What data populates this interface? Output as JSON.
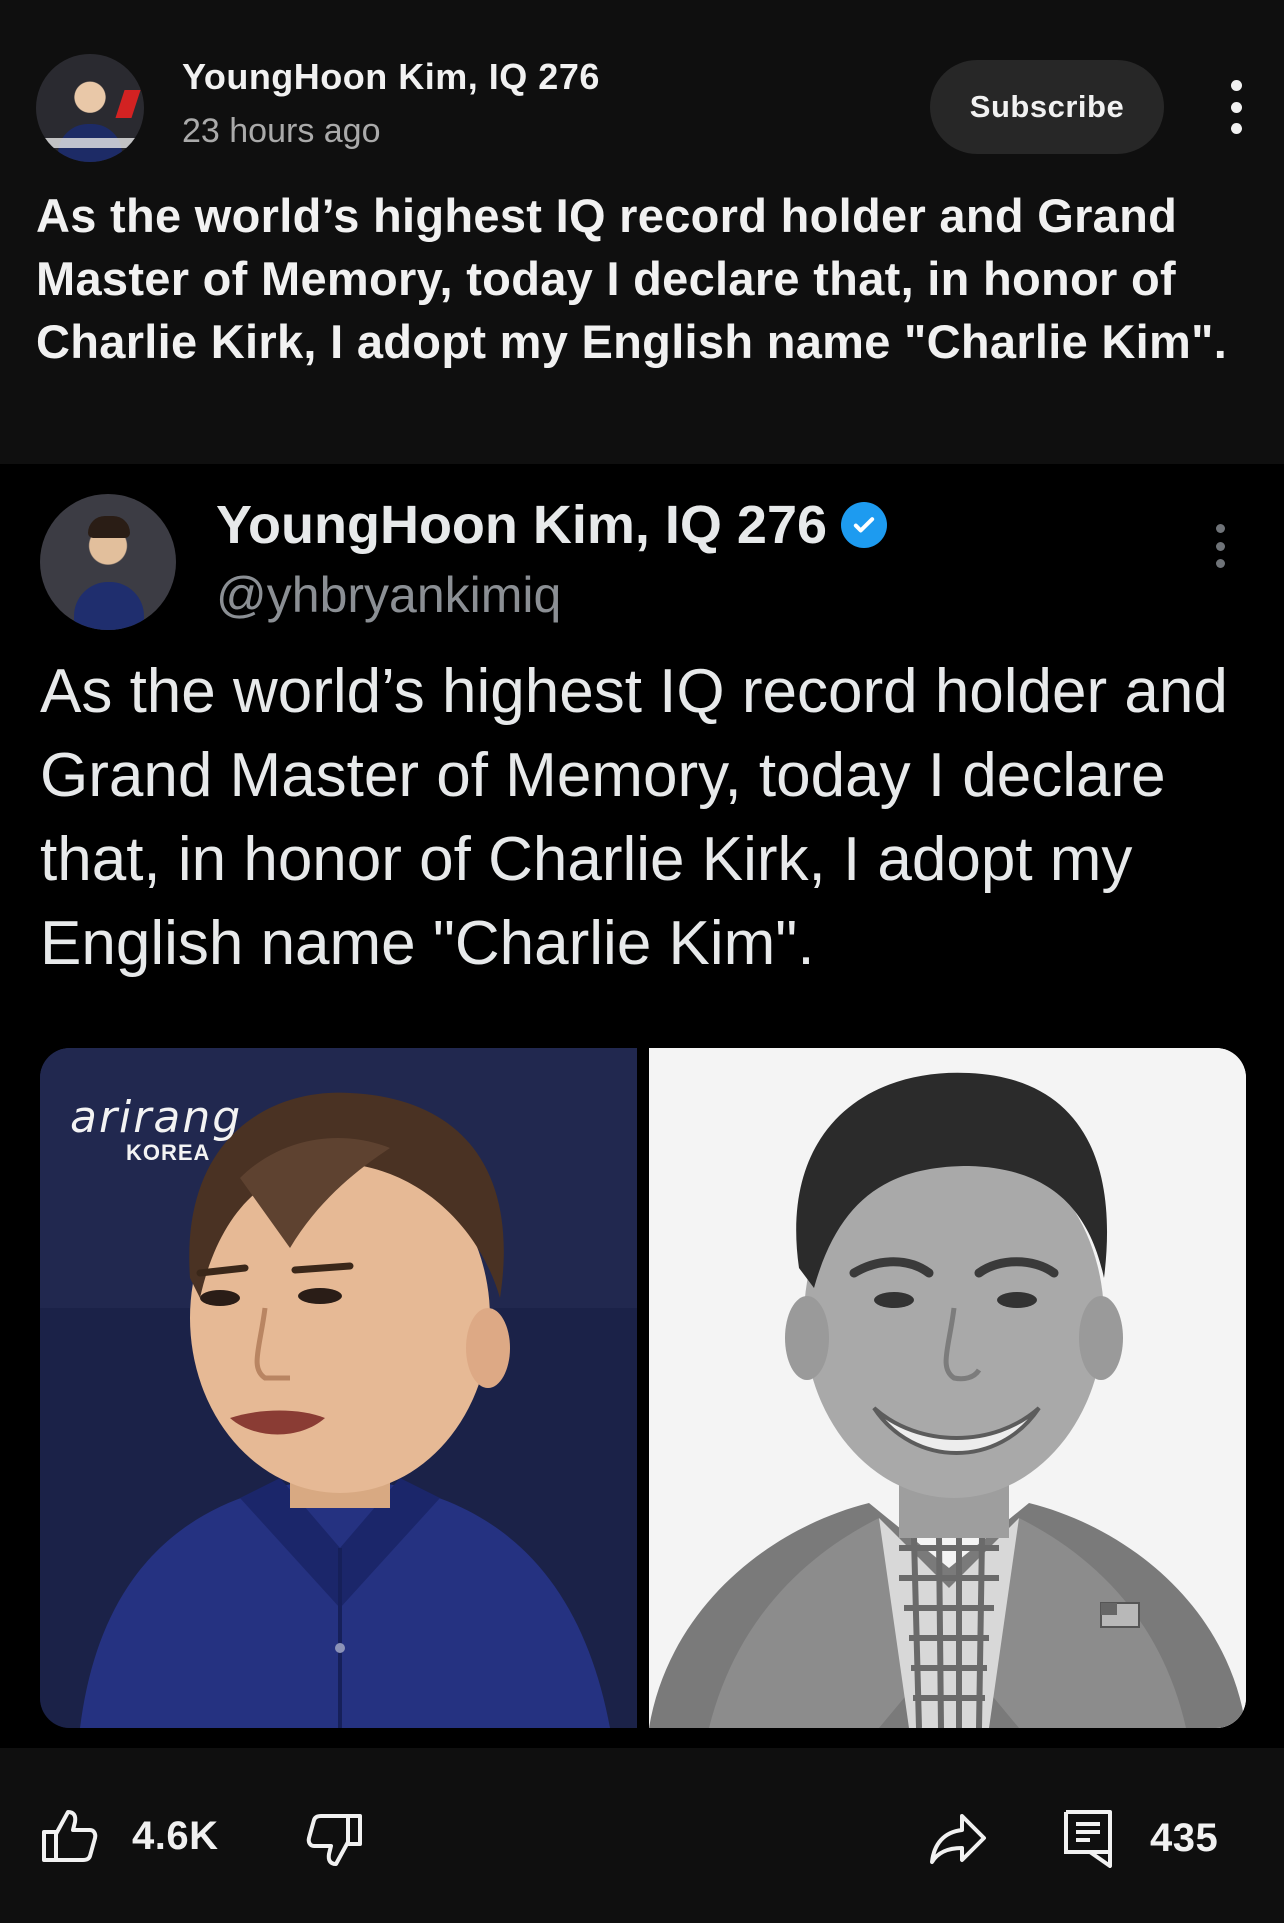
{
  "post": {
    "author": "YoungHoon Kim, IQ 276",
    "time": "23 hours ago",
    "subscribe_label": "Subscribe",
    "text": "As the world’s highest IQ record holder and Grand Master of Memory, today I declare that, in honor of Charlie Kirk, I adopt my English name \"Charlie Kim\"."
  },
  "tweet": {
    "name": "YoungHoon Kim, IQ 276",
    "handle": "@yhbryankimiq",
    "verified": true,
    "text": "As the world’s highest IQ record holder and Grand Master of Memory, today I declare that, in honor of Charlie Kirk, I adopt my English name \"Charlie Kim\".",
    "photo_left_logo": "arirang",
    "photo_left_logo_sub": "KOREA"
  },
  "actions": {
    "likes": "4.6K",
    "comments": "435"
  },
  "colors": {
    "background": "#0f0f0f",
    "button_bg": "#272727",
    "verified": "#1d9bf0",
    "secondary_text": "#aaaaaa"
  },
  "icons": [
    "more-vert-icon",
    "verified-icon",
    "thumbs-up-icon",
    "thumbs-down-icon",
    "share-icon",
    "comment-icon"
  ]
}
